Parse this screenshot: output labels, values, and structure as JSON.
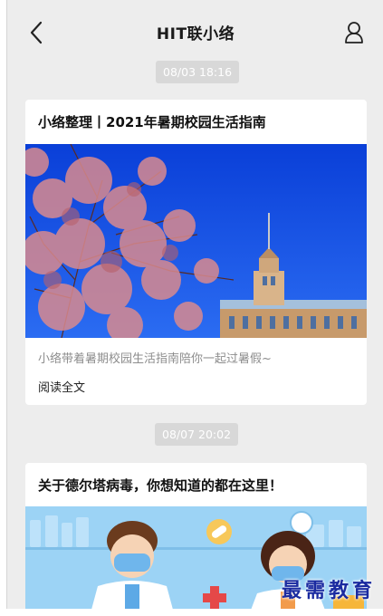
{
  "header": {
    "title": "HIT联小络",
    "back_icon": "back-arrow-icon",
    "profile_icon": "user-icon"
  },
  "messages": [
    {
      "time": "08/03 18:16",
      "title": "小络整理丨2021年暑期校园生活指南",
      "summary": "小络带着暑期校园生活指南陪你一起过暑假~",
      "read_more": "阅读全文"
    },
    {
      "time": "08/07 20:02",
      "title": "关于德尔塔病毒，你想知道的都在这里！"
    }
  ],
  "watermark": "最需教育"
}
